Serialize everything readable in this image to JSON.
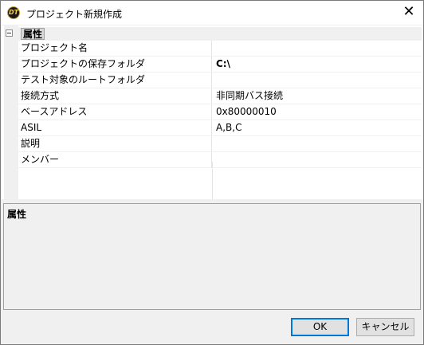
{
  "window": {
    "title": "プロジェクト新規作成",
    "app_icon_text": "DT",
    "close_glyph": "✕"
  },
  "property_grid": {
    "category_label": "属性",
    "properties": [
      {
        "name": "プロジェクト名",
        "value": "",
        "bold": false
      },
      {
        "name": "プロジェクトの保存フォルダ",
        "value": "C:\\",
        "bold": true
      },
      {
        "name": "テスト対象のルートフォルダ",
        "value": "",
        "bold": false
      },
      {
        "name": "接続方式",
        "value": "非同期バス接続",
        "bold": false
      },
      {
        "name": "ベースアドレス",
        "value": "0x80000010",
        "bold": false
      },
      {
        "name": "ASIL",
        "value": "A,B,C",
        "bold": false
      },
      {
        "name": "説明",
        "value": "",
        "bold": false
      },
      {
        "name": "メンバー",
        "value": "",
        "bold": false
      }
    ]
  },
  "description_panel": {
    "title": "属性"
  },
  "buttons": {
    "ok_label": "OK",
    "cancel_label": "キャンセル"
  },
  "colors": {
    "dialog_background": "#f0f0f0",
    "grid_background": "#ffffff",
    "default_button_border": "#0078d7"
  }
}
